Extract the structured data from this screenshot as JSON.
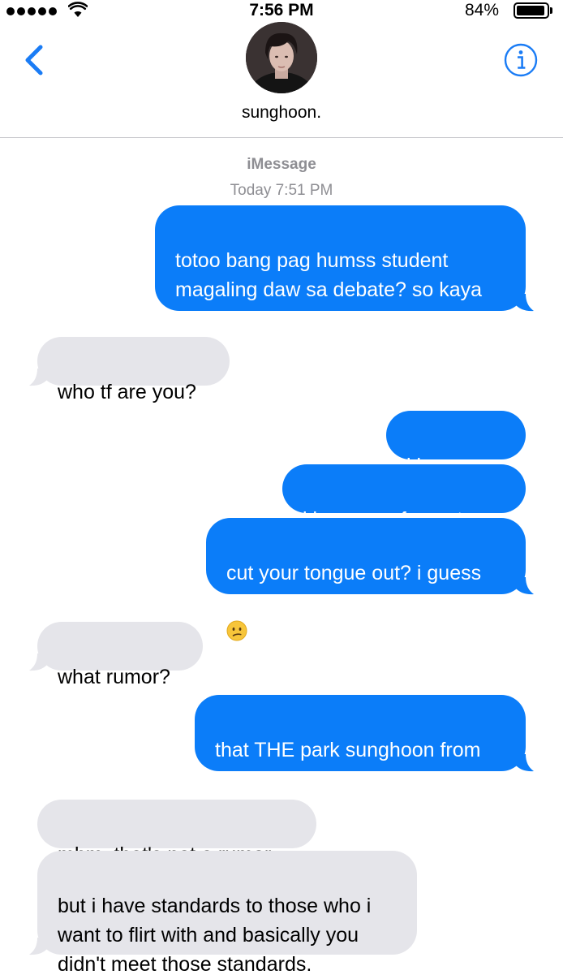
{
  "status_bar": {
    "time": "7:56 PM",
    "battery_percent": "84%",
    "battery_level": 0.84,
    "signal_bars": 5,
    "icons": [
      "signal-dots",
      "wifi-icon",
      "battery-icon"
    ]
  },
  "header": {
    "contact_name": "sunghoon.",
    "back_icon": "chevron-left-icon",
    "info_icon": "info-circle-icon",
    "accent_color": "#1a7cf5"
  },
  "thread": {
    "service": "iMessage",
    "timestamp": "Today 7:51 PM"
  },
  "messages": [
    {
      "direction": "sent",
      "text": "totoo bang pag humss student\nmagaling daw sa debate? so kaya\nmo akong ipaglaban?"
    },
    {
      "direction": "received",
      "text": "who tf are you?"
    },
    {
      "direction": "sent",
      "text": "kim sunoo"
    },
    {
      "direction": "sent",
      "text": "kim sunoo from stem"
    },
    {
      "direction": "sent",
      "text": "cut your tongue out? i guess\nrumor isn't true at all",
      "emoji": "confused-face"
    },
    {
      "direction": "received",
      "text": "what rumor?"
    },
    {
      "direction": "sent",
      "text": "that THE park sunghoon from\nhumss is good at flirting"
    },
    {
      "direction": "received",
      "text": "mhm, that's not a rumor."
    },
    {
      "direction": "received",
      "text": "but i have standards to those who i\nwant to flirt with and basically you\ndidn't meet those standards."
    }
  ],
  "colors": {
    "sent_bubble": "#0b7df9",
    "received_bubble": "#e5e5ea",
    "meta_text": "#8e8e93"
  }
}
